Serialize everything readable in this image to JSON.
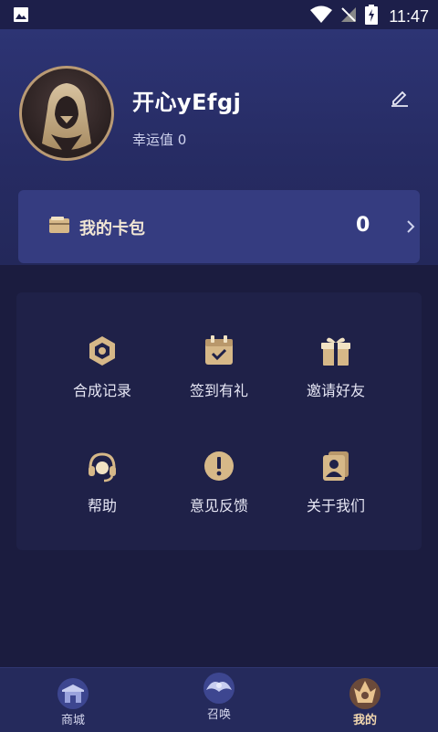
{
  "status_bar": {
    "time": "11:47"
  },
  "profile": {
    "username": "开心yEfgj",
    "luck_label": "幸运值 0"
  },
  "wallet": {
    "label": "我的卡包",
    "count": "0"
  },
  "menu": {
    "items": [
      {
        "label": "合成记录",
        "icon": "synthesis-record-icon"
      },
      {
        "label": "签到有礼",
        "icon": "calendar-check-icon"
      },
      {
        "label": "邀请好友",
        "icon": "gift-icon"
      },
      {
        "label": "帮助",
        "icon": "headset-icon"
      },
      {
        "label": "意见反馈",
        "icon": "exclamation-icon"
      },
      {
        "label": "关于我们",
        "icon": "contact-card-icon"
      }
    ]
  },
  "tabbar": {
    "tabs": [
      {
        "label": "商城",
        "icon": "shop-icon"
      },
      {
        "label": "召唤",
        "icon": "eagle-icon"
      },
      {
        "label": "我的",
        "icon": "profile-tab-icon",
        "active": true
      }
    ]
  },
  "colors": {
    "background": "#1b1c3f",
    "header": "#2d3474",
    "wallet_card": "#353c80",
    "gold_accent": "#d6b888"
  }
}
